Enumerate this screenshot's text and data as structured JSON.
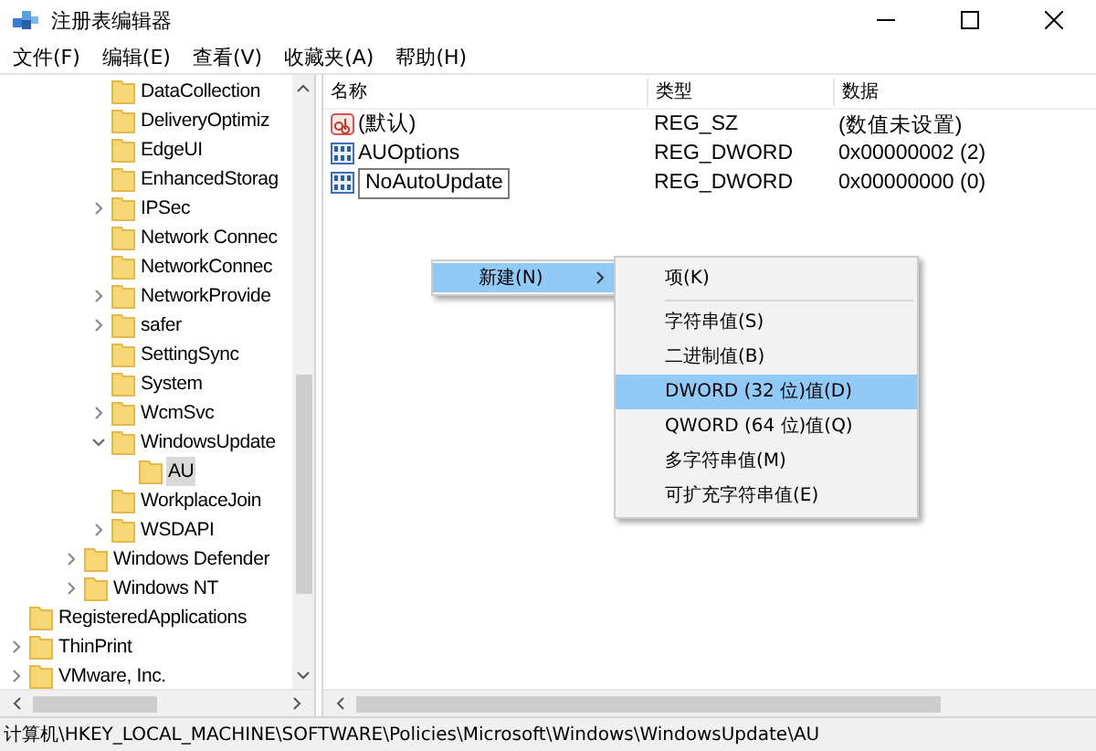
{
  "window": {
    "title": "注册表编辑器"
  },
  "menu_bar": [
    "文件(F)",
    "编辑(E)",
    "查看(V)",
    "收藏夹(A)",
    "帮助(H)"
  ],
  "tree": {
    "items": [
      {
        "children": [
          {
            "children": [
              {
                "children": [
                  {
                    "label": "DataCollection",
                    "expandable": false,
                    "selected": false
                  },
                  {
                    "label": "DeliveryOptimiz",
                    "expandable": false,
                    "selected": false
                  },
                  {
                    "label": "EdgeUI",
                    "expandable": false,
                    "selected": false
                  },
                  {
                    "label": "EnhancedStorag",
                    "expandable": false,
                    "selected": false
                  },
                  {
                    "label": "IPSec",
                    "expandable": true,
                    "expanded": false,
                    "selected": false
                  },
                  {
                    "label": "Network Connec",
                    "expandable": false,
                    "selected": false
                  },
                  {
                    "label": "NetworkConnec",
                    "expandable": false,
                    "selected": false
                  },
                  {
                    "label": "NetworkProvide",
                    "expandable": true,
                    "expanded": false,
                    "selected": false
                  },
                  {
                    "label": "safer",
                    "expandable": true,
                    "expanded": false,
                    "selected": false
                  },
                  {
                    "label": "SettingSync",
                    "expandable": false,
                    "selected": false
                  },
                  {
                    "label": "System",
                    "expandable": false,
                    "selected": false
                  },
                  {
                    "label": "WcmSvc",
                    "expandable": true,
                    "expanded": false,
                    "selected": false
                  },
                  {
                    "label": "WindowsUpdate",
                    "expandable": true,
                    "expanded": true,
                    "selected": false,
                    "children": [
                      {
                        "label": "AU",
                        "expandable": false,
                        "selected": true
                      }
                    ]
                  },
                  {
                    "label": "WorkplaceJoin",
                    "expandable": false,
                    "selected": false
                  },
                  {
                    "label": "WSDAPI",
                    "expandable": true,
                    "expanded": false,
                    "selected": false
                  }
                ]
              },
              {
                "label": "Windows Defender",
                "expandable": true,
                "expanded": false,
                "selected": false
              },
              {
                "label": "Windows NT",
                "expandable": true,
                "expanded": false,
                "selected": false
              }
            ]
          }
        ]
      },
      {
        "label": "RegisteredApplications",
        "expandable": false,
        "selected": false
      },
      {
        "label": "ThinPrint",
        "expandable": true,
        "expanded": false,
        "selected": false
      },
      {
        "label": "VMware, Inc.",
        "expandable": true,
        "expanded": false,
        "selected": false
      }
    ]
  },
  "values": {
    "columns": [
      "名称",
      "类型",
      "数据"
    ],
    "rows": [
      {
        "kind": "string",
        "name": "(默认)",
        "type": "REG_SZ",
        "data": "(数值未设置)",
        "editing": false
      },
      {
        "kind": "binary",
        "name": "AUOptions",
        "type": "REG_DWORD",
        "data": "0x00000002 (2)",
        "editing": false
      },
      {
        "kind": "binary",
        "name": "NoAutoUpdate",
        "type": "REG_DWORD",
        "data": "0x00000000 (0)",
        "editing": true
      }
    ]
  },
  "context_menu": {
    "items": [
      {
        "label": "新建(N)",
        "selected": true,
        "has_submenu": true
      }
    ],
    "submenu": {
      "items": [
        {
          "kind": "item",
          "label": "项(K)",
          "selected": false
        },
        {
          "kind": "separator"
        },
        {
          "kind": "item",
          "label": "字符串值(S)",
          "selected": false
        },
        {
          "kind": "item",
          "label": "二进制值(B)",
          "selected": false
        },
        {
          "kind": "item",
          "label": "DWORD (32 位)值(D)",
          "selected": true
        },
        {
          "kind": "item",
          "label": "QWORD (64 位)值(Q)",
          "selected": false
        },
        {
          "kind": "item",
          "label": "多字符串值(M)",
          "selected": false
        },
        {
          "kind": "item",
          "label": "可扩充字符串值(E)",
          "selected": false
        }
      ]
    }
  },
  "status_bar": "计算机\\HKEY_LOCAL_MACHINE\\SOFTWARE\\Policies\\Microsoft\\Windows\\WindowsUpdate\\AU"
}
